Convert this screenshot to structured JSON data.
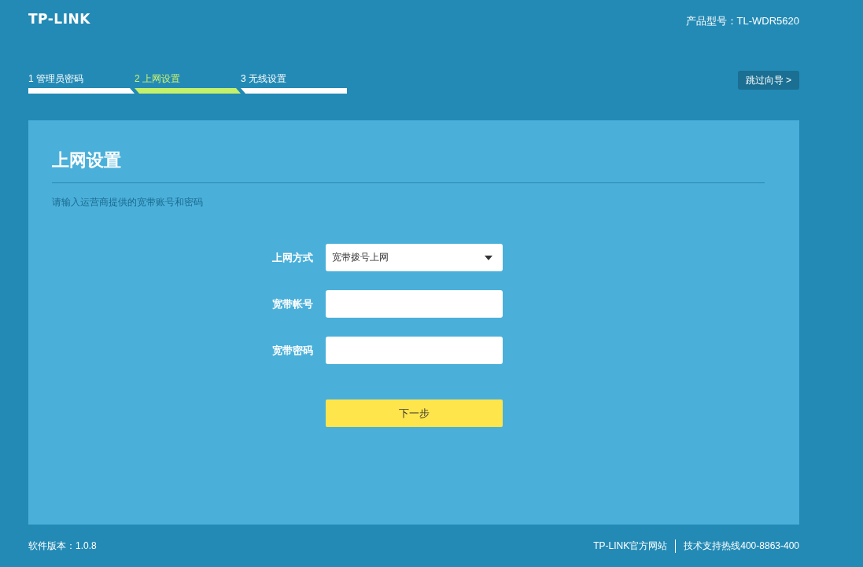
{
  "header": {
    "logo": "TP-LINK",
    "model": "产品型号：TL-WDR5620"
  },
  "steps": [
    {
      "label": "1 管理员密码",
      "selected": false
    },
    {
      "label": "2 上网设置",
      "selected": true
    },
    {
      "label": "3 无线设置",
      "selected": false
    }
  ],
  "skip_button": "跳过向导 >",
  "panel": {
    "title": "上网设置",
    "hint": "请输入运营商提供的宽带账号和密码",
    "fields": [
      {
        "label": "上网方式",
        "kind": "select",
        "value": "宽带拨号上网"
      },
      {
        "label": "宽带帐号",
        "kind": "text"
      },
      {
        "label": "宽带密码",
        "kind": "password"
      }
    ],
    "next_button": "下一步"
  },
  "footer": {
    "version": "软件版本：1.0.8",
    "links": [
      "TP-LINK官方网站",
      "技术支持热线400-8863-400"
    ]
  }
}
